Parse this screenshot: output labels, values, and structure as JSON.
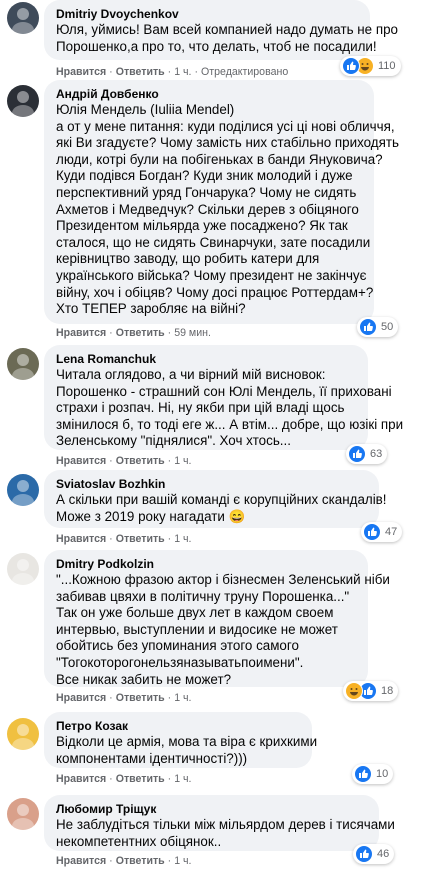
{
  "comments": [
    {
      "author": "Dmitriy Dvoychenkov",
      "lines": [
        "Юля, уймись! Вам всей компанией надо думать не про",
        "Порошенко,а про то, что делать, чтоб не посадили!"
      ],
      "like": "Нравится",
      "reply": "Ответить",
      "time": "1 ч.",
      "edited": "Отредактировано",
      "reaction_count": "110",
      "reactions": [
        "like",
        "laugh"
      ]
    },
    {
      "author": "Андрій Довбенко",
      "lines": [
        "Юлія Мендель (Iuliia Mendel)",
        "а от у мене питання: куди поділися усі ці нові обличчя,",
        "які Ви згадуєте? Чому замість них стабільно приходять",
        "люди, котрі були на побігеньках в банди Януковича?",
        "Куди подівся Богдан? Куди зник молодий і дуже",
        "перспективний уряд Гончарука? Чому не сидять",
        "Ахметов і Медведчук? Скільки дерев з обіцяного",
        "Президентом мільярда уже посаджено? Як так",
        "сталося, що не сидять Свинарчуки, зате посадили",
        "керівництво заводу, що робить катери для",
        "українського війська? Чому президент не закінчує",
        "війну, хоч і обіцяв? Чому досі працює Роттердам+?",
        "Хто ТЕПЕР заробляє на війні?"
      ],
      "like": "Нравится",
      "reply": "Ответить",
      "time": "59 мин.",
      "reaction_count": "50",
      "reactions": [
        "like"
      ]
    },
    {
      "author": "Lena Romanchuk",
      "lines": [
        "Читала оглядово, а чи вірний мій висновок:",
        "Порошенко - страшний сон Юлі Мендель, її приховані",
        "страхи і розпач. Ні, ну якби при цій владі щось",
        "змінилося б, то тоді еге ж... А втім... добре, що юзікі при",
        "Зеленському \"піднялися\". Хоч хтось..."
      ],
      "like": "Нравится",
      "reply": "Ответить",
      "time": "1 ч.",
      "reaction_count": "63",
      "reactions": [
        "like"
      ]
    },
    {
      "author": "Sviatoslav Bozhkin",
      "lines": [
        "А скільки при вашій команді є корупційних скандалів!",
        "Може з 2019 року нагадати 😄"
      ],
      "like": "Нравится",
      "reply": "Ответить",
      "time": "1 ч.",
      "reaction_count": "47",
      "reactions": [
        "like"
      ]
    },
    {
      "author": "Dmitry Podkolzin",
      "lines": [
        "\"...Кожною фразою актор і бізнесмен Зеленський ніби",
        "забивав цвяхи в політичну труну Порошенка...\"",
        "Так он уже больше двух лет в каждом своем",
        "интервью, выступлении и видосике не может",
        "обойтись без упоминания этого самого",
        "\"Тогокоторогонельзяназыватьпоимени\".",
        "Все никак забить не может?"
      ],
      "like": "Нравится",
      "reply": "Ответить",
      "time": "1 ч.",
      "reaction_count": "18",
      "reactions": [
        "laugh",
        "like"
      ]
    },
    {
      "author": "Петро Козак",
      "lines": [
        "Відколи це армія, мова та віра є крихкими",
        "компонентами ідентичності?)))"
      ],
      "like": "Нравится",
      "reply": "Ответить",
      "time": "1 ч.",
      "reaction_count": "10",
      "reactions": [
        "like"
      ]
    },
    {
      "author": "Любомир Тріщук",
      "lines": [
        "Не заблудіться тільки між мільярдом дерев і тисячами",
        "некомпетентних обіцянок.."
      ],
      "like": "Нравится",
      "reply": "Ответить",
      "time": "1 ч.",
      "reaction_count": "46",
      "reactions": [
        "like"
      ]
    }
  ],
  "colors": {
    "bubble": "#f0f2f5",
    "meta": "#65676b",
    "like": "#1877f2",
    "laugh": "#f7b125"
  }
}
